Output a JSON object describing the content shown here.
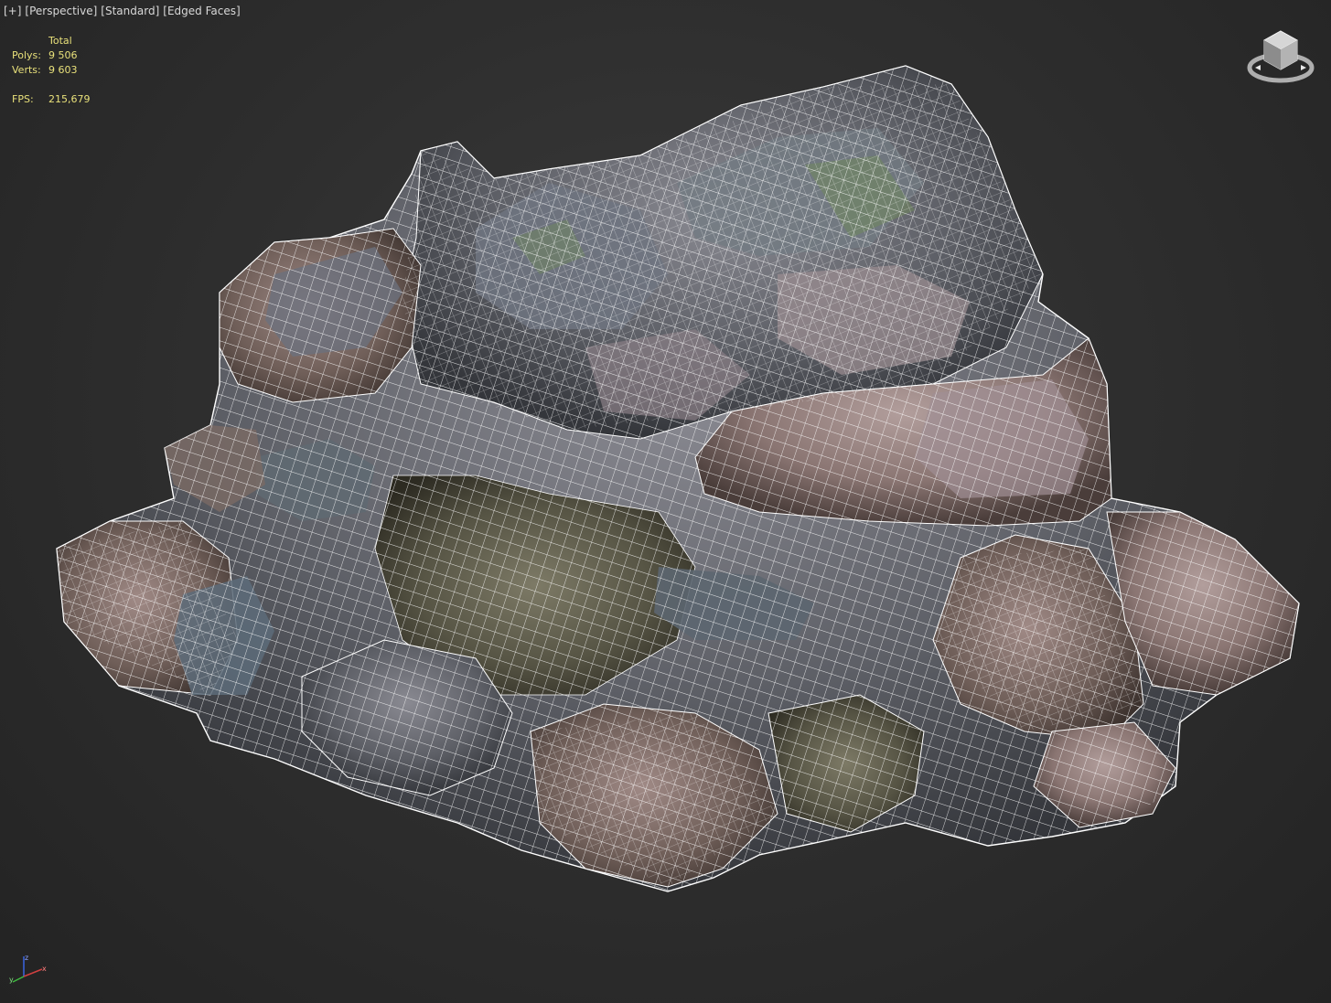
{
  "viewport": {
    "labels": [
      "[+]",
      "[Perspective]",
      "[Standard]",
      "[Edged Faces]"
    ]
  },
  "stats": {
    "header": "Total",
    "polys_label": "Polys:",
    "polys_value": "9 506",
    "verts_label": "Verts:",
    "verts_value": "9 603",
    "fps_label": "FPS:",
    "fps_value": "215,679"
  },
  "colors": {
    "background": "#2f2f2f",
    "stats_text": "#e8e07a",
    "wireframe": "#ffffff",
    "label_text": "#d8d8d8"
  },
  "icons": {
    "viewcube": "viewcube-icon",
    "axis": "axis-tripod-icon"
  }
}
